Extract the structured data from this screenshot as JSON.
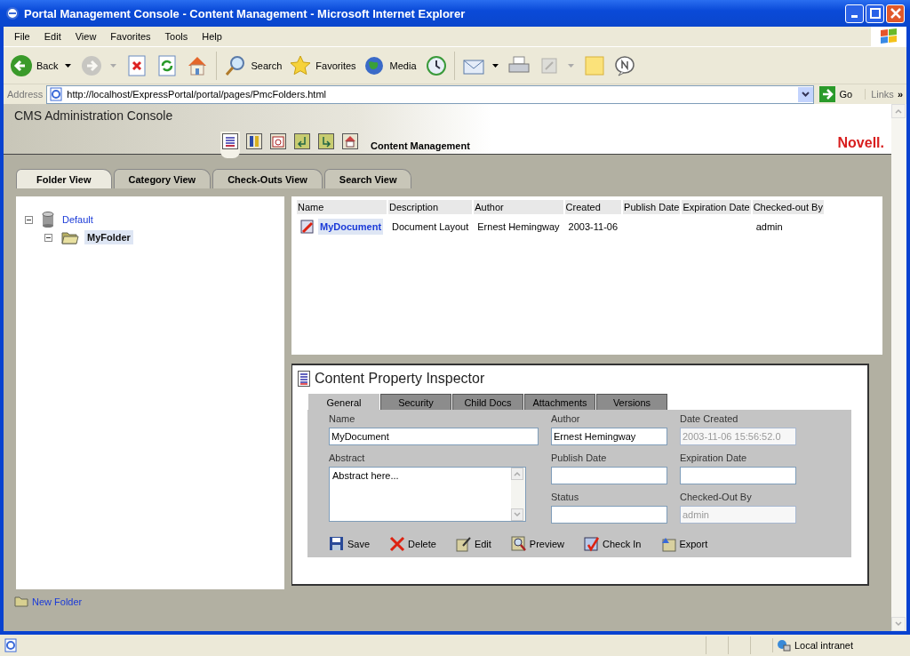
{
  "window": {
    "title": "Portal Management Console - Content Management - Microsoft Internet Explorer"
  },
  "menu": [
    "File",
    "Edit",
    "View",
    "Favorites",
    "Tools",
    "Help"
  ],
  "toolbar": [
    {
      "kind": "back",
      "label": "Back",
      "disabled": false,
      "dropdown": true
    },
    {
      "kind": "forward",
      "disabled": true,
      "dropdown": true
    },
    {
      "kind": "stop",
      "disabled": false,
      "dropdown": false
    },
    {
      "kind": "refresh",
      "disabled": false,
      "dropdown": false
    },
    {
      "kind": "home",
      "disabled": false,
      "dropdown": false
    },
    {
      "kind": "search",
      "label": "Search",
      "disabled": false,
      "dropdown": false
    },
    {
      "kind": "favorites",
      "label": "Favorites",
      "disabled": false,
      "dropdown": false
    },
    {
      "kind": "media",
      "label": "Media",
      "disabled": false,
      "dropdown": false
    },
    {
      "kind": "history",
      "disabled": false,
      "dropdown": false
    },
    {
      "kind": "mail",
      "disabled": false,
      "dropdown": true
    },
    {
      "kind": "print",
      "disabled": false,
      "dropdown": false
    },
    {
      "kind": "edit",
      "disabled": true,
      "dropdown": true
    },
    {
      "kind": "note",
      "disabled": false,
      "dropdown": false
    },
    {
      "kind": "messenger",
      "disabled": false,
      "dropdown": false
    }
  ],
  "address": {
    "label": "Address",
    "url": "http://localhost/ExpressPortal/portal/pages/PmcFolders.html",
    "go": "Go",
    "links": "Links",
    "more": "»"
  },
  "app": {
    "title": "CMS Administration Console",
    "section": "Content Management",
    "logo": "Novell."
  },
  "header_icons": [
    {
      "kind": "list",
      "selected": true
    },
    {
      "kind": "book",
      "selected": false
    },
    {
      "kind": "calendar",
      "selected": false
    },
    {
      "kind": "checkout",
      "selected": false
    },
    {
      "kind": "checkin",
      "selected": false
    },
    {
      "kind": "home",
      "selected": false
    }
  ],
  "tabs": [
    {
      "label": "Folder View",
      "selected": true
    },
    {
      "label": "Category View",
      "selected": false
    },
    {
      "label": "Check-Outs View",
      "selected": false
    },
    {
      "label": "Search View",
      "selected": false
    }
  ],
  "tree": [
    {
      "label": "Default",
      "kind": "database",
      "expanded": true,
      "selected": false,
      "children": [
        {
          "label": "MyFolder",
          "kind": "folder",
          "expanded": true,
          "selected": true
        }
      ]
    }
  ],
  "table": {
    "columns": [
      "Name",
      "Description",
      "Author",
      "Created",
      "Publish Date",
      "Expiration Date",
      "Checked-out By"
    ],
    "rows": [
      {
        "selected": true,
        "cells": [
          "MyDocument",
          "Document Layout",
          "Ernest Hemingway",
          "2003-11-06",
          "",
          "",
          "admin"
        ]
      }
    ]
  },
  "inspector": {
    "title": "Content Property Inspector",
    "tabs": [
      {
        "label": "General",
        "selected": true
      },
      {
        "label": "Security",
        "selected": false
      },
      {
        "label": "Child Docs",
        "selected": false
      },
      {
        "label": "Attachments",
        "selected": false
      },
      {
        "label": "Versions",
        "selected": false
      }
    ],
    "fields": [
      {
        "label": "Name",
        "kind": "text",
        "value": "MyDocument",
        "disabled": false
      },
      {
        "label": "Author",
        "kind": "text",
        "value": "Ernest Hemingway",
        "disabled": false
      },
      {
        "label": "Date Created",
        "kind": "text",
        "value": "2003-11-06 15:56:52.0",
        "disabled": true
      },
      {
        "label": "Abstract",
        "kind": "textarea",
        "value": "Abstract here...",
        "disabled": false
      },
      {
        "label": "Publish Date",
        "kind": "text",
        "disabled": false
      },
      {
        "label": "Expiration Date",
        "kind": "text",
        "disabled": false
      },
      {
        "label": "Status",
        "kind": "text",
        "disabled": false
      },
      {
        "label": "Checked-Out By",
        "kind": "text",
        "value": "admin",
        "disabled": true
      }
    ],
    "actions": [
      {
        "kind": "save",
        "label": "Save"
      },
      {
        "kind": "delete",
        "label": "Delete"
      },
      {
        "kind": "edit",
        "label": "Edit"
      },
      {
        "kind": "preview",
        "label": "Preview"
      },
      {
        "kind": "checkin",
        "label": "Check In"
      },
      {
        "kind": "export",
        "label": "Export"
      }
    ]
  },
  "footer": {
    "link": "New Folder"
  },
  "status_bar": {
    "zone": "Local intranet"
  }
}
